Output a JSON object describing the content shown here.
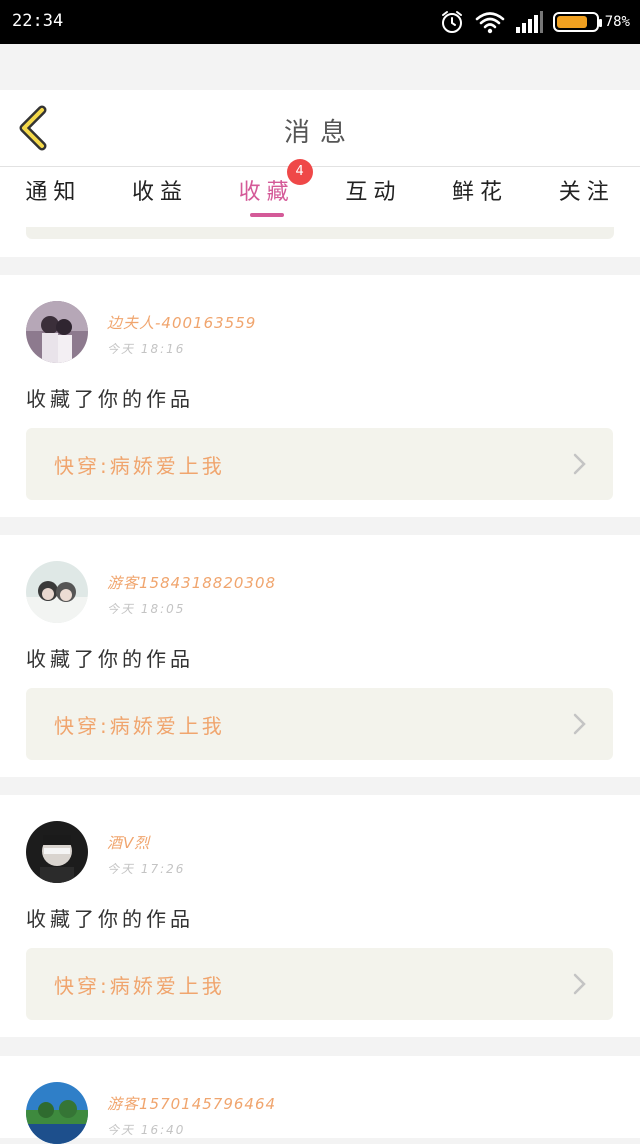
{
  "status_bar": {
    "time": "22:34",
    "battery_percent": "78%",
    "battery_level": 0.78
  },
  "header": {
    "title": "消息"
  },
  "tabs": [
    {
      "label": "通知"
    },
    {
      "label": "收益"
    },
    {
      "label": "收藏",
      "badge": "4",
      "active": true
    },
    {
      "label": "互动"
    },
    {
      "label": "鲜花"
    },
    {
      "label": "关注"
    }
  ],
  "feed": [
    {
      "username": "边夫人-400163559",
      "time": "今天 18:16",
      "action": "收藏了你的作品",
      "work_title": "快穿:病娇爱上我"
    },
    {
      "username": "游客1584318820308",
      "time": "今天 18:05",
      "action": "收藏了你的作品",
      "work_title": "快穿:病娇爱上我"
    },
    {
      "username": "酒V烈",
      "time": "今天 17:26",
      "action": "收藏了你的作品",
      "work_title": "快穿:病娇爱上我"
    },
    {
      "username": "游客1570145796464",
      "time": "今天 16:40"
    }
  ],
  "colors": {
    "accent_pink": "#d45a98",
    "username_orange": "#f0a56e",
    "badge_red": "#ef4848",
    "card_bg": "#f3f3ec"
  },
  "icons": {
    "back": "chevron-left-icon",
    "row_arrow": "chevron-right-icon"
  }
}
